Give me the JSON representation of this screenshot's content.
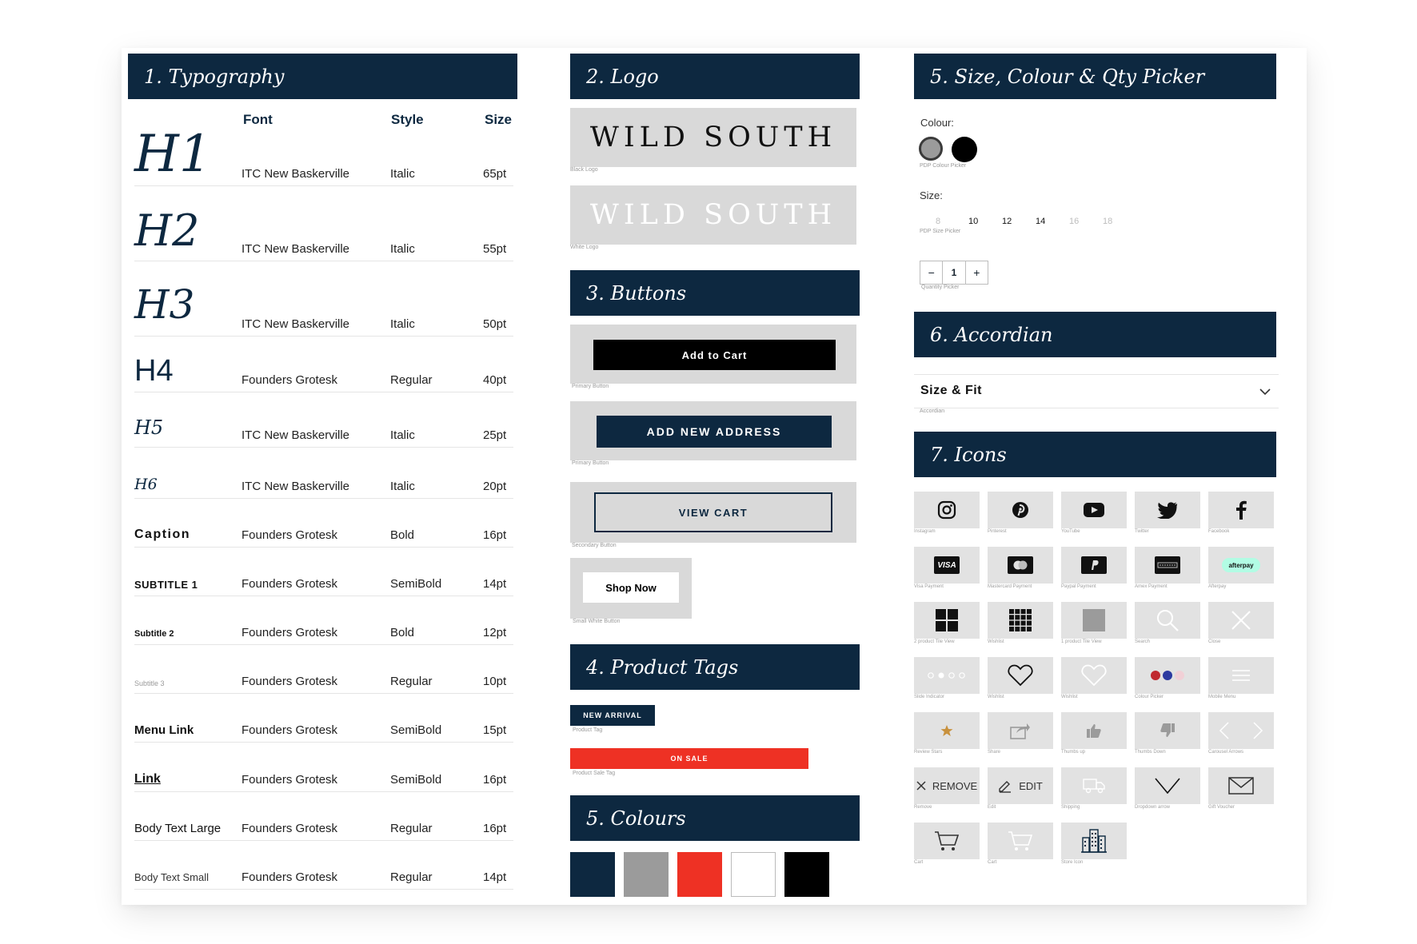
{
  "typography": {
    "header": "1. Typography",
    "columns": {
      "font": "Font",
      "style": "Style",
      "size": "Size"
    },
    "rows": [
      {
        "name": "H1",
        "font": "ITC New Baskerville",
        "style": "Italic",
        "size": "65pt"
      },
      {
        "name": "H2",
        "font": "ITC New Baskerville",
        "style": "Italic",
        "size": "55pt"
      },
      {
        "name": "H3",
        "font": "ITC New Baskerville",
        "style": "Italic",
        "size": "50pt"
      },
      {
        "name": "H4",
        "font": "Founders Grotesk",
        "style": "Regular",
        "size": "40pt"
      },
      {
        "name": "H5",
        "font": "ITC New Baskerville",
        "style": "Italic",
        "size": "25pt"
      },
      {
        "name": "H6",
        "font": "ITC New Baskerville",
        "style": "Italic",
        "size": "20pt"
      },
      {
        "name": "Caption",
        "font": "Founders Grotesk",
        "style": "Bold",
        "size": "16pt"
      },
      {
        "name": "SUBTITLE 1",
        "font": "Founders Grotesk",
        "style": "SemiBold",
        "size": "14pt"
      },
      {
        "name": "Subtitle 2",
        "font": "Founders Grotesk",
        "style": "Bold",
        "size": "12pt"
      },
      {
        "name": "Subtitle 3",
        "font": "Founders Grotesk",
        "style": "Regular",
        "size": "10pt"
      },
      {
        "name": "Menu Link",
        "font": "Founders Grotesk",
        "style": "SemiBold",
        "size": "15pt"
      },
      {
        "name": "Link",
        "font": "Founders Grotesk",
        "style": "SemiBold",
        "size": "16pt"
      },
      {
        "name": "Body Text Large",
        "font": "Founders Grotesk",
        "style": "Regular",
        "size": "16pt"
      },
      {
        "name": "Body Text Small",
        "font": "Founders Grotesk",
        "style": "Regular",
        "size": "14pt"
      }
    ]
  },
  "logo": {
    "header": "2. Logo",
    "black_logo_text": "WILD SOUTH",
    "black_logo_label": "Black Logo",
    "white_logo_text": "WILD SOUTH",
    "white_logo_label": "White Logo"
  },
  "buttons": {
    "header": "3. Buttons",
    "add_to_cart": "Add to Cart",
    "add_to_cart_label": "Primary Button",
    "add_new_address": "ADD NEW ADDRESS",
    "add_new_address_label": "Primary Button",
    "view_cart": "VIEW CART",
    "view_cart_label": "Secondary Button",
    "shop_now": "Shop Now",
    "shop_now_label": "Small White Button"
  },
  "product_tags": {
    "header": "4. Product Tags",
    "new_arrival": "NEW ARRIVAL",
    "new_arrival_label": "Product Tag",
    "on_sale": "ON SALE",
    "on_sale_label": "Product Sale Tag"
  },
  "colours": {
    "header": "5. Colours",
    "swatches": [
      "#0d2840",
      "#9b9b9b",
      "#ee3124",
      "#ffffff",
      "#000000"
    ]
  },
  "picker": {
    "header": "5. Size, Colour & Qty Picker",
    "colour_label": "Colour:",
    "colour_picker_label": "PDP Colour Picker",
    "size_label": "Size:",
    "sizes": [
      "8",
      "10",
      "12",
      "14",
      "16",
      "18"
    ],
    "size_picker_label": "PDP Size Picker",
    "qty_minus": "−",
    "qty_value": "1",
    "qty_plus": "+",
    "qty_picker_label": "Quantity Picker"
  },
  "accordian": {
    "header": "6. Accordian",
    "title": "Size & Fit",
    "label": "Accordian"
  },
  "icons": {
    "header": "7. Icons",
    "labels": {
      "instagram": "Instagram",
      "pinterest": "Pinterest",
      "youtube": "YouTube",
      "twitter": "Twitter",
      "facebook": "Facebook",
      "visa": "Visa Payment",
      "mastercard": "Mastercard Payment",
      "paypal": "Paypal Payment",
      "amex": "Amex Payment",
      "afterpay": "Afterpay",
      "tile2": "2 product Tile View",
      "wishlist_grid": "Wishlist",
      "tile1": "1 product Tile View",
      "search": "Search",
      "close": "Close",
      "slide": "Slide Indicator",
      "wishlist1": "Wishlist",
      "wishlist2": "Wishlist",
      "colour_picker": "Colour Picker",
      "mobile_menu": "Mobile Menu",
      "review": "Review Stars",
      "share": "Share",
      "thumbs_up": "Thumbs up",
      "thumbs_down": "Thumbs Down",
      "carousel": "Carousel Arrows",
      "remove": "Remove",
      "edit": "Edit",
      "shipping": "Shipping",
      "dropdown": "Dropdown arrow",
      "gift": "Gift Voucher",
      "cart1": "Cart",
      "cart2": "Cart",
      "store": "Store Icon"
    },
    "visa_text": "VISA",
    "afterpay_text": "afterpay",
    "remove_text": "REMOVE",
    "edit_text": "EDIT"
  }
}
